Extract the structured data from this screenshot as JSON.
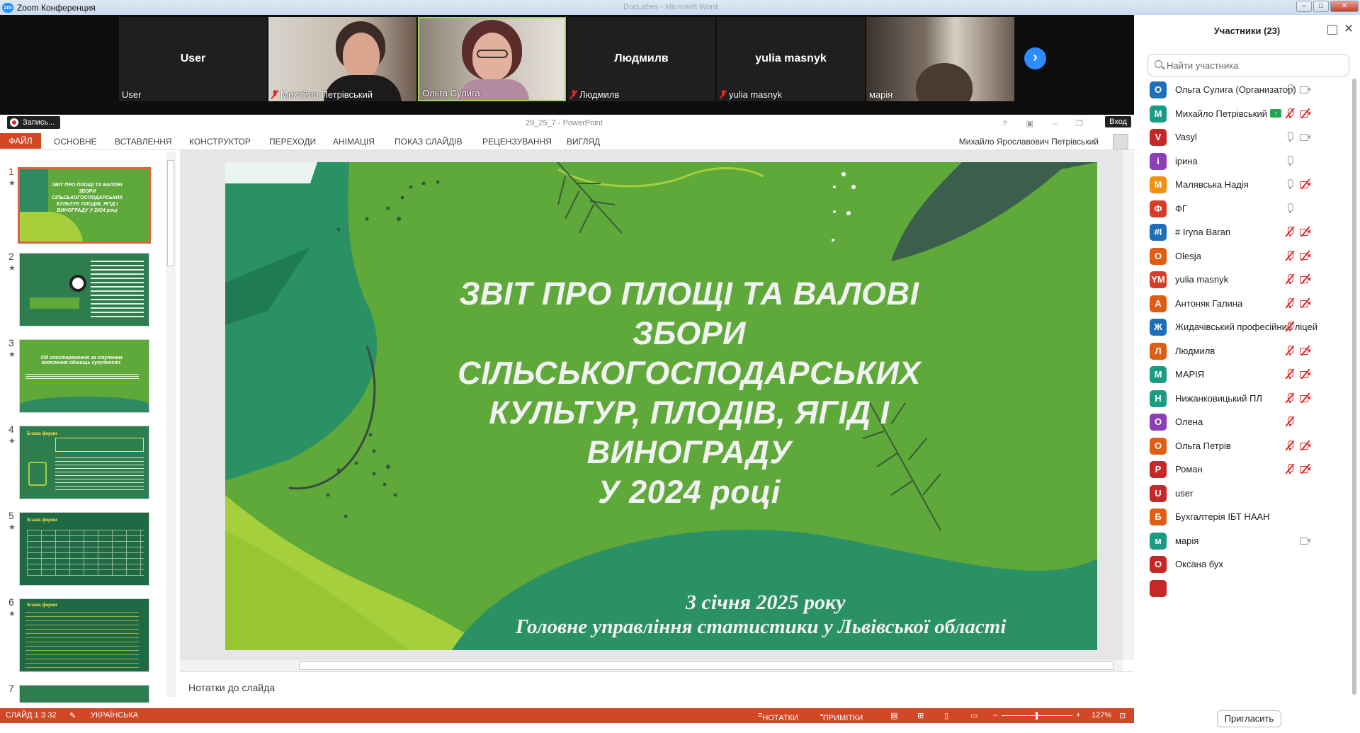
{
  "titlebar": {
    "app_title": "Zoom Конференция",
    "app_icon": "zm",
    "ghost_title": "DocLabes - Microsoft Word"
  },
  "videos": [
    {
      "type": "name",
      "big": "User",
      "label": "User",
      "muted": false
    },
    {
      "type": "video",
      "label": "Михайло Петрівський",
      "muted": true
    },
    {
      "type": "video",
      "label": "Ольга Сулига",
      "muted": false
    },
    {
      "type": "name",
      "big": "Людмилв",
      "label": "Людмилв",
      "muted": true
    },
    {
      "type": "name",
      "big": "yulia masnyk",
      "label": "yulia masnyk",
      "muted": true
    },
    {
      "type": "video",
      "label": "марія",
      "muted": false
    }
  ],
  "ppt": {
    "record_label": "Запись...",
    "doc_title": "29_25_7 - PowerPoint",
    "signin": "Вход",
    "file_tab": "ФАЙЛ",
    "tabs": [
      "ОСНОВНЕ",
      "ВСТАВЛЕННЯ",
      "КОНСТРУКТОР",
      "ПЕРЕХОДИ",
      "АНІМАЦІЯ",
      "ПОКАЗ СЛАЙДІВ",
      "РЕЦЕНЗУВАННЯ",
      "ВИГЛЯД"
    ],
    "user_name": "Михайло Ярославович Петрівський",
    "thumbnails": [
      {
        "num": "1",
        "star": "★",
        "text": "ЗВІТ ПРО ПЛОЩІ ТА ВАЛОВІ ЗБОРИ СІЛЬСЬКОГОСПОДАРСЬКИХ КУЛЬТУР, ПЛОДІВ, ЯГІД І ВИНОГРАДУ У 2024 році"
      },
      {
        "num": "2",
        "star": "★",
        "text": ""
      },
      {
        "num": "3",
        "star": "★",
        "text": "Хід спостереження за ступенем охоплення одиниць сукупності."
      },
      {
        "num": "4",
        "star": "★",
        "text": "Бланк форми"
      },
      {
        "num": "5",
        "star": "★",
        "text": "Бланк форми"
      },
      {
        "num": "6",
        "star": "★",
        "text": "Бланк форми"
      },
      {
        "num": "7",
        "star": "",
        "text": ""
      }
    ],
    "slide": {
      "title_lines": [
        "ЗВІТ ПРО ПЛОЩІ ТА ВАЛОВІ",
        "ЗБОРИ",
        "СІЛЬСЬКОГОСПОДАРСЬКИХ",
        "КУЛЬТУР, ПЛОДІВ, ЯГІД І",
        "ВИНОГРАДУ",
        "У 2024 році"
      ],
      "date": "3 січня  2025 року",
      "org": "Головне управління статистики у Львівської області"
    },
    "notes_label": "Нотатки до слайда",
    "status": {
      "slide": "СЛАЙД 1 З 32",
      "language": "УКРАЇНСЬКА",
      "notes_btn": "НОТАТКИ",
      "comments_btn": "ПРИМІТКИ",
      "zoom": "127%"
    }
  },
  "participants": {
    "title": "Участники (23)",
    "search_placeholder": "Найти участника",
    "invite_label": "Пригласить",
    "items": [
      {
        "initial": "О",
        "color": "#1f6fb8",
        "name": "Ольга Сулига (Организатор)",
        "mic": "on",
        "cam": "on",
        "share": false
      },
      {
        "initial": "М",
        "color": "#1a9b85",
        "name": "Михайло Петрівський",
        "mic": "off",
        "cam": "off",
        "share": true
      },
      {
        "initial": "V",
        "color": "#c62828",
        "name": "Vasyl",
        "mic": "on",
        "cam": "on",
        "share": false
      },
      {
        "initial": "і",
        "color": "#8e3fb5",
        "name": "ірина",
        "mic": "on",
        "cam": "",
        "share": false
      },
      {
        "initial": "М",
        "color": "#f29111",
        "name": "Малявська Надія",
        "mic": "on",
        "cam": "off",
        "share": false
      },
      {
        "initial": "Ф",
        "color": "#d83b2a",
        "name": "ФГ",
        "mic": "on",
        "cam": "",
        "share": false
      },
      {
        "initial": "#I",
        "color": "#1f6fb8",
        "name": "# Iryna Baran",
        "mic": "off",
        "cam": "off",
        "share": false
      },
      {
        "initial": "O",
        "color": "#e05d14",
        "name": "Olesja",
        "mic": "off",
        "cam": "off",
        "share": false
      },
      {
        "initial": "YM",
        "color": "#d83b2a",
        "name": "yulia masnyk",
        "mic": "off",
        "cam": "off",
        "share": false
      },
      {
        "initial": "А",
        "color": "#e05d14",
        "name": "Антоняк Галина",
        "mic": "off",
        "cam": "off",
        "share": false
      },
      {
        "initial": "Ж",
        "color": "#1f6fb8",
        "name": "Жидачівський професійний ліцей",
        "mic": "off",
        "cam": "",
        "share": false
      },
      {
        "initial": "Л",
        "color": "#e05d14",
        "name": "Людмилв",
        "mic": "off",
        "cam": "off",
        "share": false
      },
      {
        "initial": "М",
        "color": "#1a9b85",
        "name": "МАРІЯ",
        "mic": "off",
        "cam": "off",
        "share": false
      },
      {
        "initial": "Н",
        "color": "#1a9b85",
        "name": "Нижанковицький ПЛ",
        "mic": "off",
        "cam": "off",
        "share": false
      },
      {
        "initial": "О",
        "color": "#8e3fb5",
        "name": "Олена",
        "mic": "off",
        "cam": "",
        "share": false
      },
      {
        "initial": "О",
        "color": "#e05d14",
        "name": "Ольга Петрів",
        "mic": "off",
        "cam": "off",
        "share": false
      },
      {
        "initial": "Р",
        "color": "#c62828",
        "name": "Роман",
        "mic": "off",
        "cam": "off",
        "share": false
      },
      {
        "initial": "U",
        "color": "#c62828",
        "name": "user",
        "mic": "",
        "cam": "",
        "share": false
      },
      {
        "initial": "Б",
        "color": "#e05d14",
        "name": "Бухгалтерія ІБТ НААН",
        "mic": "",
        "cam": "",
        "share": false
      },
      {
        "initial": "м",
        "color": "#1a9b85",
        "name": "марія",
        "mic": "",
        "cam": "on",
        "share": false
      },
      {
        "initial": "О",
        "color": "#c62828",
        "name": "Оксана бух",
        "mic": "",
        "cam": "",
        "share": false
      },
      {
        "initial": "",
        "color": "#c62828",
        "name": "",
        "mic": "",
        "cam": "",
        "share": false
      }
    ]
  }
}
